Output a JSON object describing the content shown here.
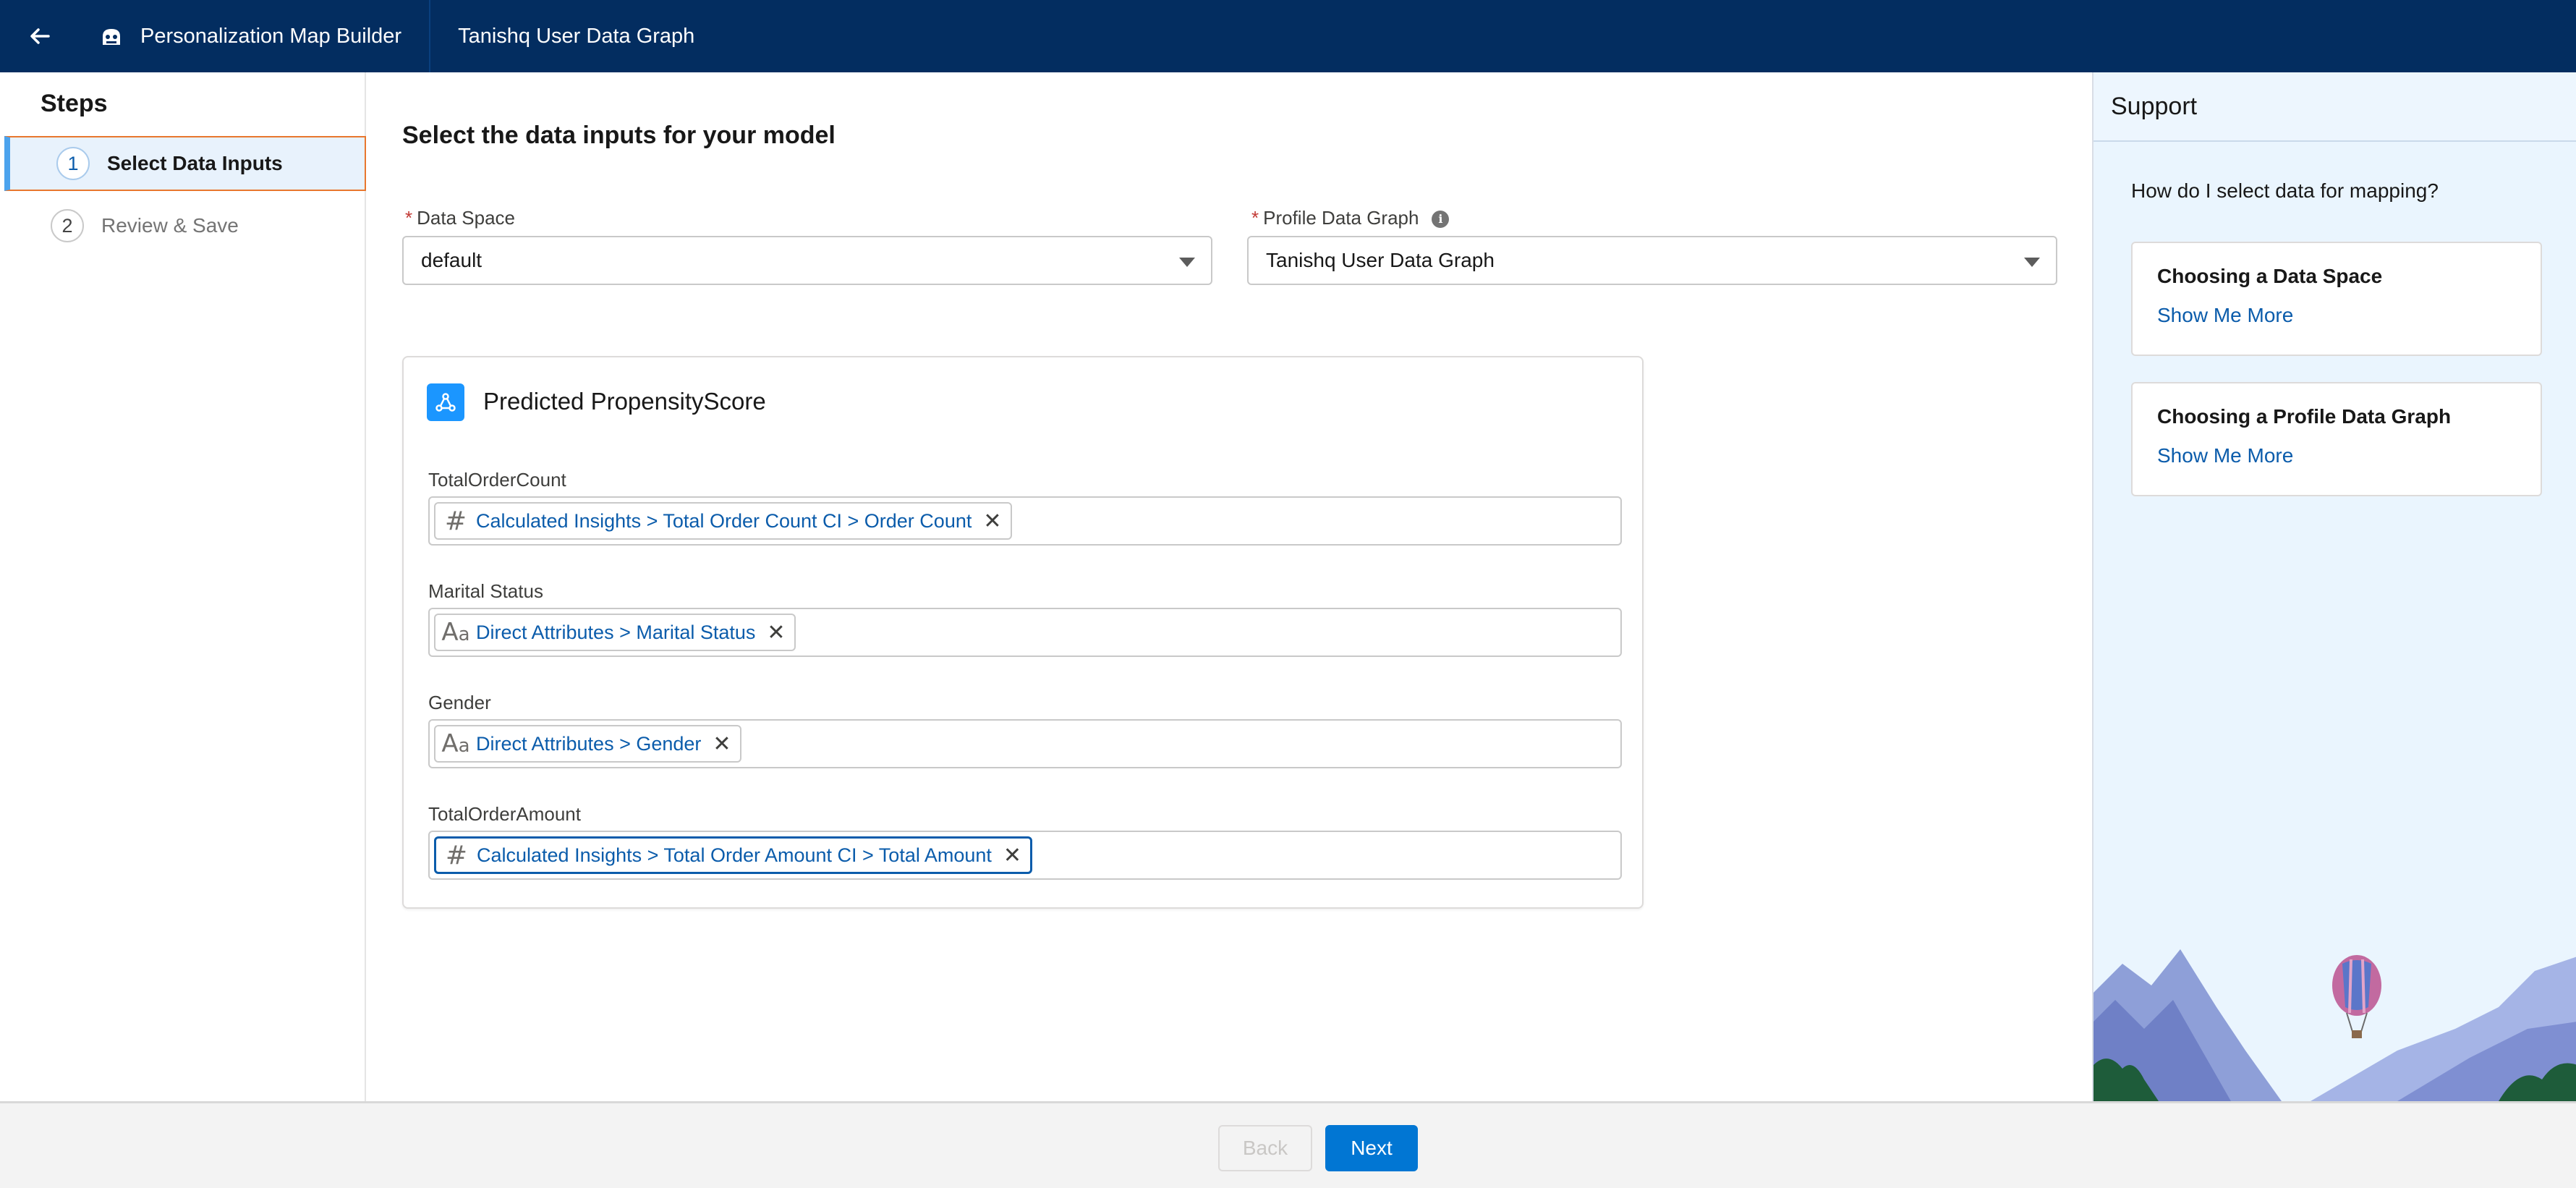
{
  "header": {
    "app_title": "Personalization Map Builder",
    "graph_title": "Tanishq User Data Graph",
    "bg_color": "#032d60"
  },
  "steps": {
    "heading": "Steps",
    "items": [
      {
        "number": "1",
        "label": "Select Data Inputs",
        "state": "active"
      },
      {
        "number": "2",
        "label": "Review & Save",
        "state": "inactive"
      }
    ]
  },
  "main": {
    "title": "Select the data inputs for your model",
    "data_space": {
      "label": "Data Space",
      "value": "default"
    },
    "profile_graph": {
      "label": "Profile Data Graph",
      "value": "Tanishq User Data Graph"
    },
    "card": {
      "title": "Predicted PropensityScore",
      "inputs": [
        {
          "label": "TotalOrderCount",
          "type": "number",
          "value": "Calculated Insights > Total Order Count CI > Order Count"
        },
        {
          "label": "Marital Status",
          "type": "text",
          "value": "Direct Attributes > Marital Status"
        },
        {
          "label": "Gender",
          "type": "text",
          "value": "Direct Attributes > Gender"
        },
        {
          "label": "TotalOrderAmount",
          "type": "number",
          "value": "Calculated Insights > Total Order Amount CI > Total Amount"
        }
      ]
    }
  },
  "support": {
    "heading": "Support",
    "question": "How do I select data for mapping?",
    "cards": [
      {
        "title": "Choosing a Data Space",
        "link": "Show Me More"
      },
      {
        "title": "Choosing a Profile Data Graph",
        "link": "Show Me More"
      }
    ]
  },
  "footer": {
    "back_label": "Back",
    "next_label": "Next",
    "accent": "#0176d3"
  },
  "icons": {
    "number_type": "#",
    "text_type_big": "A",
    "text_type_small": "a",
    "remove": "✕",
    "info": "i"
  }
}
